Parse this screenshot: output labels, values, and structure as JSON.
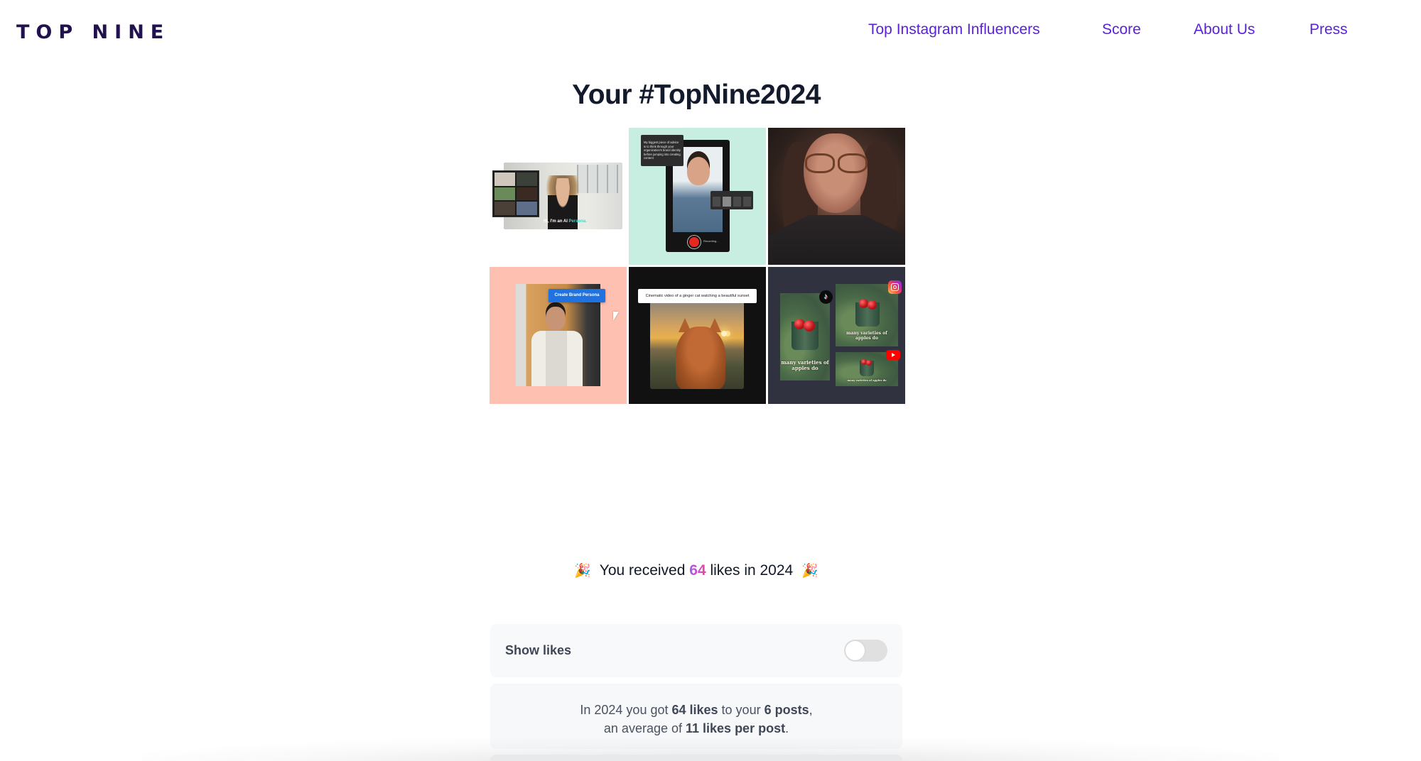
{
  "header": {
    "logo": "TOP NINE",
    "nav": [
      {
        "label": "Top Instagram Influencers"
      },
      {
        "label": "Score"
      },
      {
        "label": "About Us"
      },
      {
        "label": "Press"
      }
    ]
  },
  "page_title": "Your #TopNine2024",
  "grid": {
    "tiles": [
      {
        "description": "AI persona video with gallery of presenters",
        "caption_prefix": "Hi, I'm an AI ",
        "caption_highlight": "Persona."
      },
      {
        "description": "Phone recorder with teleprompter",
        "advice": "My biggest piece of advice is to think through your organization's brand identity before jumping into creating content"
      },
      {
        "description": "Woman with glasses portrait"
      },
      {
        "description": "Create Brand Persona screen",
        "button_label": "Create Brand Persona"
      },
      {
        "description": "Ginger cat watching sunset",
        "prompt": "Cinematic video of a ginger cat watching a beautiful sunset"
      },
      {
        "description": "Apple bucket repurposed for TikTok, Instagram, YouTube",
        "caption_tall": "many varieties of apples do",
        "caption_square": "many varieties of apples do",
        "caption_wide": "many varieties of apples do"
      }
    ]
  },
  "likes_banner": {
    "prefix": "You received",
    "count": "64",
    "suffix": "likes in 2024",
    "emoji": "🎉"
  },
  "show_likes": {
    "label": "Show likes",
    "enabled": false
  },
  "summary": {
    "p1": "In 2024 you got ",
    "likes": "64 likes",
    "p2": " to your ",
    "posts": "6 posts",
    "p3": ",",
    "p4": "an average of ",
    "avg": "11 likes per post",
    "p5": "."
  },
  "colors": {
    "brand": "#22114f",
    "nav_link": "#5a22d6",
    "likes_gradient_start": "#a855f7",
    "likes_gradient_end": "#ec4899"
  }
}
